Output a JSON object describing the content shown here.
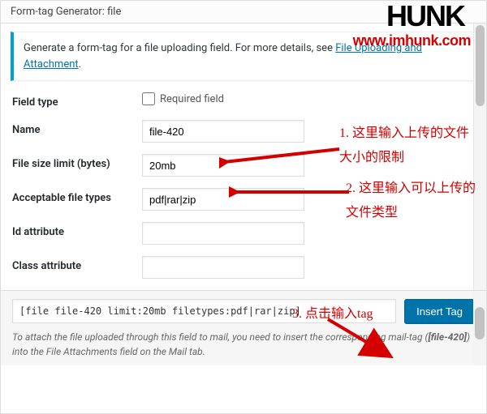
{
  "modal": {
    "title": "Form-tag Generator: file",
    "info_prefix": "Generate a form-tag for a file uploading field. For more details, see ",
    "info_link1": "File Uploading and Attachment",
    "info_suffix": "."
  },
  "fields": {
    "field_type_label": "Field type",
    "required_label": "Required field",
    "name_label": "Name",
    "name_value": "file-420",
    "size_label": "File size limit (bytes)",
    "size_value": "20mb",
    "types_label": "Acceptable file types",
    "types_value": "pdf|rar|zip",
    "id_label": "Id attribute",
    "id_value": "",
    "class_label": "Class attribute",
    "class_value": ""
  },
  "footer": {
    "code": "[file file-420 limit:20mb filetypes:pdf|rar|zip]",
    "insert_label": "Insert Tag",
    "note_prefix": "To attach the file uploaded through this field to mail, you need to insert the corresponding mail-tag (",
    "note_tag": "[file-420]",
    "note_suffix": ") into the File Attachments field on the Mail tab."
  },
  "watermark": {
    "logo": "HUNK",
    "url": "www.imhunk.com"
  },
  "annotations": {
    "a1": "1. 这里输入上传的文件大小的限制",
    "a2": "2. 这里输入可以上传的文件类型",
    "a3": "3. 点击输入tag"
  }
}
